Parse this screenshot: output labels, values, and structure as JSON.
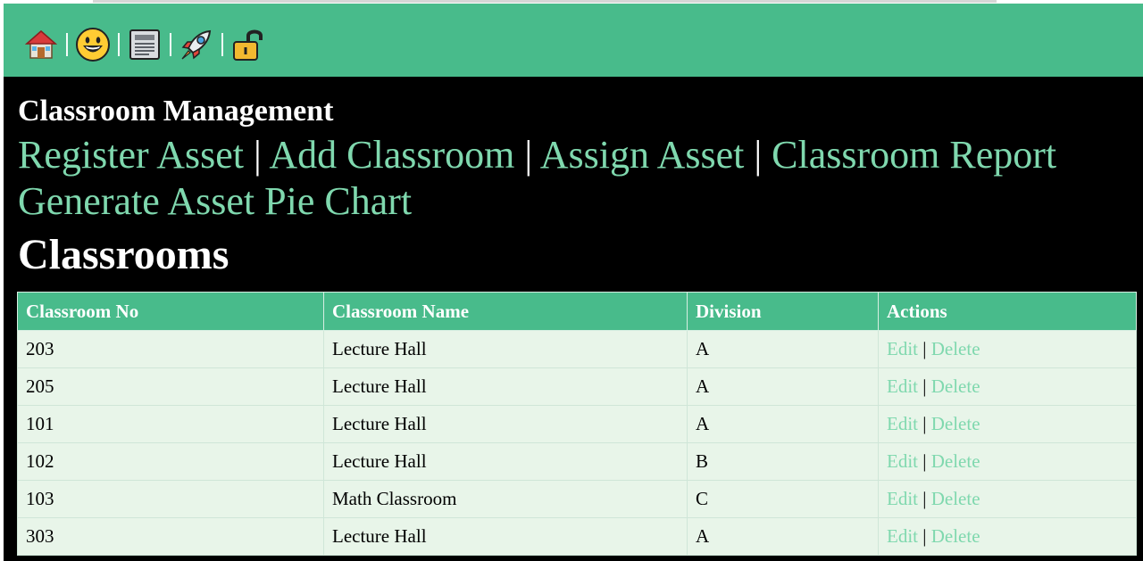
{
  "topbar": {
    "icons": [
      {
        "name": "home-icon"
      },
      {
        "name": "smiley-icon"
      },
      {
        "name": "newspaper-icon"
      },
      {
        "name": "rocket-icon"
      },
      {
        "name": "lock-icon"
      }
    ]
  },
  "header": {
    "section_title": "Classroom Management",
    "nav": {
      "register_asset": "Register Asset",
      "add_classroom": "Add Classroom",
      "assign_asset": "Assign Asset",
      "classroom_report": "Classroom Report",
      "generate_pie_chart": "Generate Asset Pie Chart",
      "separator": "|"
    },
    "page_title": "Classrooms"
  },
  "table": {
    "headers": [
      "Classroom No",
      "Classroom Name",
      "Division",
      "Actions"
    ],
    "rows": [
      {
        "no": "203",
        "name": "Lecture Hall",
        "division": "A",
        "edit": "Edit",
        "sep": "|",
        "delete": "Delete"
      },
      {
        "no": "205",
        "name": "Lecture Hall",
        "division": "A",
        "edit": "Edit",
        "sep": "|",
        "delete": "Delete"
      },
      {
        "no": "101",
        "name": "Lecture Hall",
        "division": "A",
        "edit": "Edit",
        "sep": "|",
        "delete": "Delete"
      },
      {
        "no": "102",
        "name": "Lecture Hall",
        "division": "B",
        "edit": "Edit",
        "sep": "|",
        "delete": "Delete"
      },
      {
        "no": "103",
        "name": "Math Classroom",
        "division": "C",
        "edit": "Edit",
        "sep": "|",
        "delete": "Delete"
      },
      {
        "no": "303",
        "name": "Lecture Hall",
        "division": "A",
        "edit": "Edit",
        "sep": "|",
        "delete": "Delete"
      }
    ]
  },
  "colors": {
    "accent_green": "#48bb8b",
    "link_green": "#7fd8ae",
    "row_bg": "#e8f5e9",
    "main_bg": "#000000"
  }
}
